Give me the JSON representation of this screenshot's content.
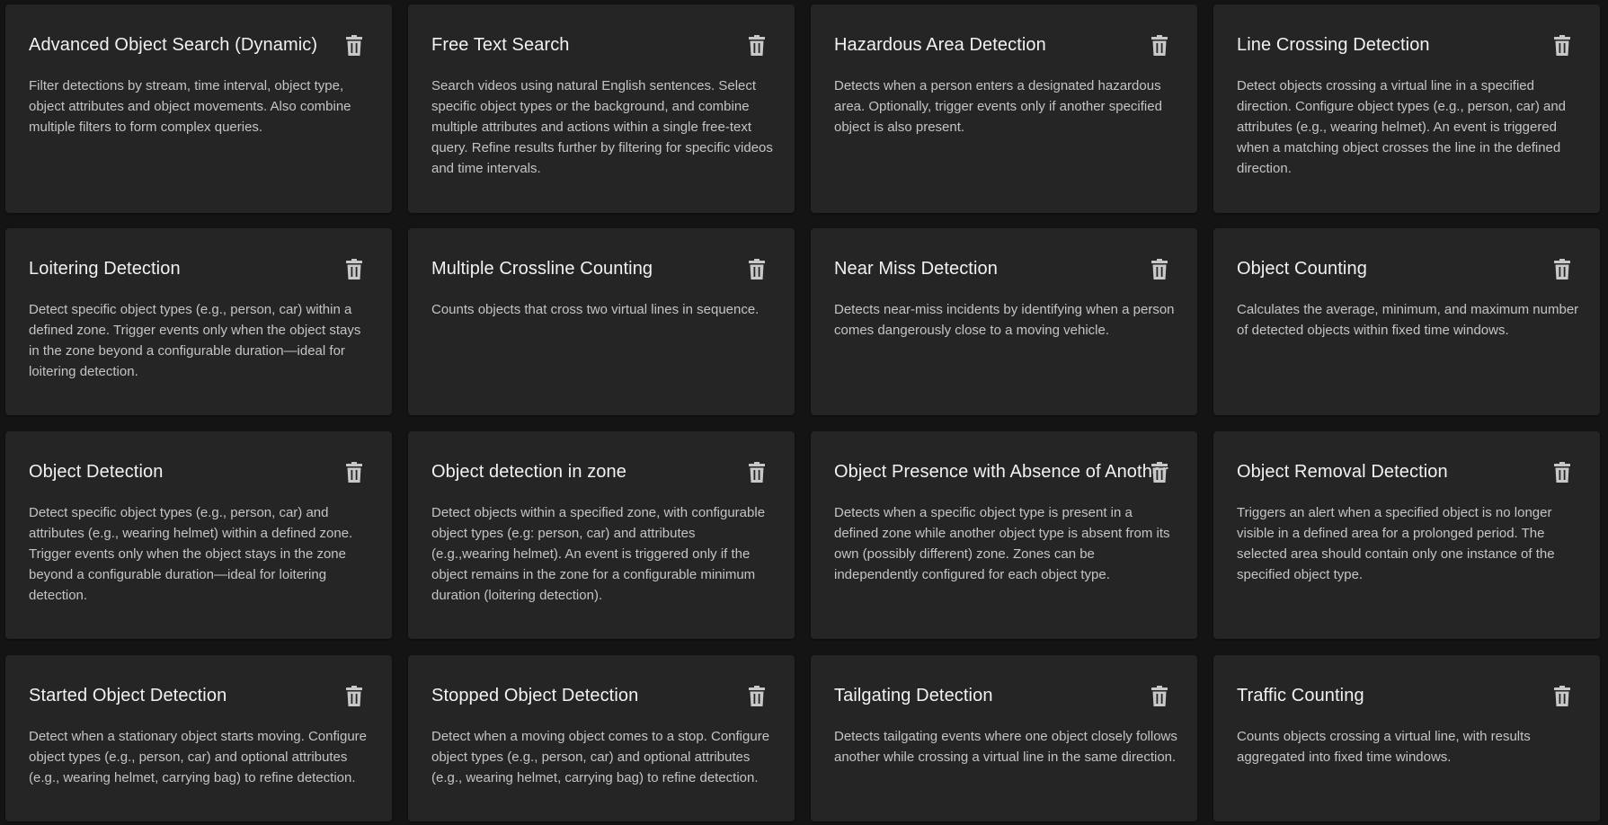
{
  "cards": [
    {
      "title": "Advanced Object Search (Dynamic)",
      "description": "Filter detections by stream, time interval, object type, object attributes and object movements. Also combine multiple filters to form complex queries.",
      "icon": "trash-icon"
    },
    {
      "title": "Free Text Search",
      "description": "Search videos using natural English sentences. Select specific object types or the background, and combine multiple attributes and actions within a single free-text query. Refine results further by filtering for specific videos and time intervals.",
      "icon": "trash-icon"
    },
    {
      "title": "Hazardous Area Detection",
      "description": "Detects when a person enters a designated hazardous area. Optionally, trigger events only if another specified object is also present.",
      "icon": "trash-icon"
    },
    {
      "title": "Line Crossing Detection",
      "description": "Detect objects crossing a virtual line in a specified direction. Configure object types (e.g., person, car) and attributes (e.g., wearing helmet). An event is triggered when a matching object crosses the line in the defined direction.",
      "icon": "trash-icon"
    },
    {
      "title": "Loitering Detection",
      "description": "Detect specific object types (e.g., person, car) within a defined zone. Trigger events only when the object stays in the zone beyond a configurable duration—ideal for loitering detection.",
      "icon": "trash-icon"
    },
    {
      "title": "Multiple Crossline Counting",
      "description": "Counts objects that cross two virtual lines in sequence.",
      "icon": "trash-icon"
    },
    {
      "title": "Near Miss Detection",
      "description": "Detects near-miss incidents by identifying when a person comes dangerously close to a moving vehicle.",
      "icon": "trash-icon"
    },
    {
      "title": "Object Counting",
      "description": "Calculates the average, minimum, and maximum number of detected objects within fixed time windows.",
      "icon": "trash-icon"
    },
    {
      "title": "Object Detection",
      "description": "Detect specific object types (e.g., person, car) and attributes (e.g., wearing helmet) within a defined zone. Trigger events only when the object stays in the zone beyond a configurable duration—ideal for loitering detection.",
      "icon": "trash-icon"
    },
    {
      "title": "Object detection in zone",
      "description": "Detect objects within a specified zone, with configurable object types (e.g: person, car) and attributes (e.g.,wearing helmet). An event is triggered only if the object remains in the zone for a configurable minimum duration (loitering detection).",
      "icon": "trash-icon"
    },
    {
      "title": "Object Presence with Absence of Another",
      "description": "Detects when a specific object type is present in a defined zone while another object type is absent from its own (possibly different) zone. Zones can be independently configured for each object type.",
      "icon": "trash-icon"
    },
    {
      "title": "Object Removal Detection",
      "description": "Triggers an alert when a specified object is no longer visible in a defined area for a prolonged period. The selected area should contain only one instance of the specified object type.",
      "icon": "trash-icon"
    },
    {
      "title": "Started Object Detection",
      "description": "Detect when a stationary object starts moving. Configure object types (e.g., person, car) and optional attributes (e.g., wearing helmet, carrying bag) to refine detection.",
      "icon": "trash-icon"
    },
    {
      "title": "Stopped Object Detection",
      "description": "Detect when a moving object comes to a stop. Configure object types (e.g., person, car) and optional attributes (e.g., wearing helmet, carrying bag) to refine detection.",
      "icon": "trash-icon"
    },
    {
      "title": "Tailgating Detection",
      "description": "Detects tailgating events where one object closely follows another while crossing a virtual line in the same direction.",
      "icon": "trash-icon"
    },
    {
      "title": "Traffic Counting",
      "description": "Counts objects crossing a virtual line, with results aggregated into fixed time windows.",
      "icon": "trash-icon"
    }
  ],
  "colors": {
    "background": "#141414",
    "card": "#252525",
    "title": "#f2f2f2",
    "description": "#c4c4c4",
    "icon": "#c8c8c8"
  }
}
